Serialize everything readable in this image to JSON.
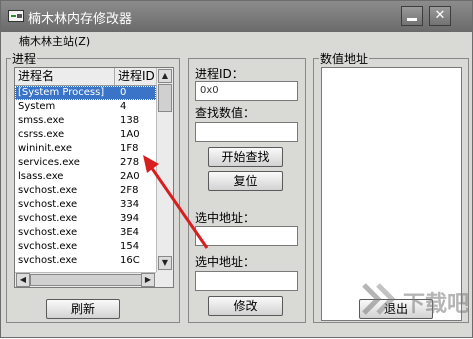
{
  "window": {
    "title": "楠木林内存修改器",
    "minimize_label": "",
    "close_label": "✕"
  },
  "menu": {
    "items": [
      {
        "label": "楠木林主站(Z)"
      }
    ]
  },
  "process_group": {
    "label": "进程",
    "columns": [
      "进程名",
      "进程ID"
    ],
    "rows": [
      {
        "name": "[System Process]",
        "pid": "0",
        "selected": true
      },
      {
        "name": "System",
        "pid": "4"
      },
      {
        "name": "smss.exe",
        "pid": "138"
      },
      {
        "name": "csrss.exe",
        "pid": "1A0"
      },
      {
        "name": "wininit.exe",
        "pid": "1F8"
      },
      {
        "name": "services.exe",
        "pid": "278"
      },
      {
        "name": "lsass.exe",
        "pid": "2A0"
      },
      {
        "name": "svchost.exe",
        "pid": "2F8"
      },
      {
        "name": "svchost.exe",
        "pid": "334"
      },
      {
        "name": "svchost.exe",
        "pid": "394"
      },
      {
        "name": "svchost.exe",
        "pid": "3E4"
      },
      {
        "name": "svchost.exe",
        "pid": "154"
      },
      {
        "name": "svchost.exe",
        "pid": "16C"
      }
    ],
    "refresh_label": "刷新"
  },
  "controls": {
    "pid_label": "进程ID：",
    "pid_value": "0x0",
    "search_value_label": "查找数值：",
    "search_value": "",
    "start_search_label": "开始查找",
    "reset_label": "复位",
    "selected_addr_label_1": "选中地址：",
    "selected_addr_value_1": "",
    "selected_addr_label_2": "选中地址：",
    "selected_addr_value_2": "",
    "modify_label": "修改"
  },
  "address_group": {
    "label": "数值地址",
    "exit_label": "退出"
  },
  "watermark": {
    "text": "下载吧"
  },
  "colors": {
    "selection": "#3a74c8",
    "annotation_arrow": "#d81e1e"
  }
}
